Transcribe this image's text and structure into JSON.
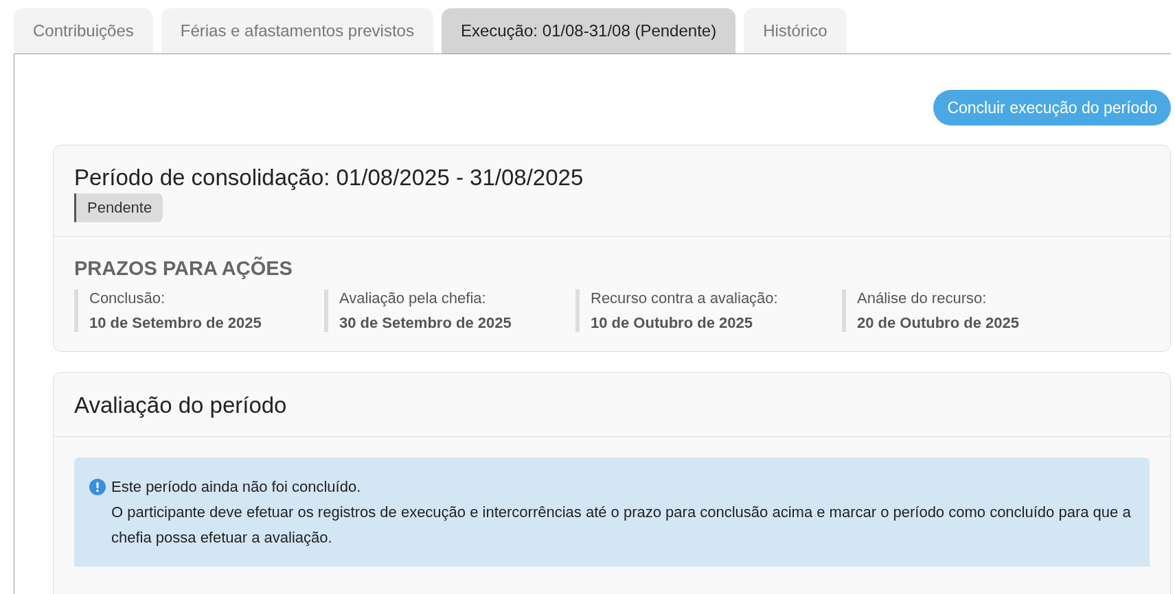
{
  "tabs": [
    {
      "label": "Contribuições",
      "selected": false
    },
    {
      "label": "Férias e afastamentos previstos",
      "selected": false
    },
    {
      "label": "Execução: 01/08-31/08 (Pendente)",
      "selected": true
    },
    {
      "label": "Histórico",
      "selected": false
    }
  ],
  "action_button": "Concluir execução do período",
  "period_card": {
    "title": "Período de consolidação: 01/08/2025 - 31/08/2025",
    "status": "Pendente",
    "deadlines_heading": "PRAZOS PARA AÇÕES",
    "deadlines": [
      {
        "label": "Conclusão:",
        "date": "10 de Setembro de 2025"
      },
      {
        "label": "Avaliação pela chefia:",
        "date": "30 de Setembro de 2025"
      },
      {
        "label": "Recurso contra a avaliação:",
        "date": "10 de Outubro de 2025"
      },
      {
        "label": "Análise do recurso:",
        "date": "20 de Outubro de 2025"
      }
    ]
  },
  "evaluation_card": {
    "title": "Avaliação do período",
    "alert": {
      "title": "Este período ainda não foi concluído.",
      "message": "O participante deve efetuar os registros de execução e intercorrências até o prazo para conclusão acima e marcar o período como concluído para que a chefia possa efetuar a avaliação."
    }
  }
}
